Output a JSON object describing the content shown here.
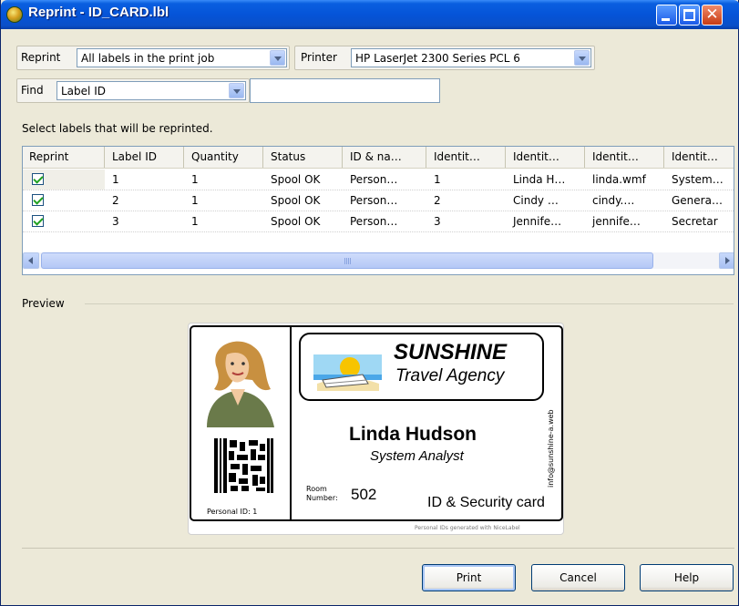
{
  "window": {
    "title": "Reprint - ID_CARD.lbl",
    "close_glyph": "✕"
  },
  "toolbar": {
    "reprint_label": "Reprint",
    "reprint_value": "All labels in the print job",
    "printer_label": "Printer",
    "printer_value": "HP LaserJet 2300 Series PCL 6",
    "find_label": "Find",
    "find_field_value": "Label ID",
    "find_text": ""
  },
  "instruction": "Select labels that will be reprinted.",
  "grid": {
    "columns": [
      "Reprint",
      "Label ID",
      "Quantity",
      "Status",
      "ID & na…",
      "Identit…",
      "Identit…",
      "Identit…",
      "Identit…"
    ],
    "rows": [
      {
        "checked": true,
        "cells": [
          "1",
          "1",
          "Spool OK",
          "Person…",
          "1",
          "Linda H…",
          "linda.wmf",
          "System…"
        ]
      },
      {
        "checked": true,
        "cells": [
          "2",
          "1",
          "Spool OK",
          "Person…",
          "2",
          "Cindy …",
          "cindy.…",
          "Genera…"
        ]
      },
      {
        "checked": true,
        "cells": [
          "3",
          "1",
          "Spool OK",
          "Person…",
          "3",
          "Jennife…",
          "jennife…",
          "Secretar"
        ]
      }
    ]
  },
  "preview": {
    "section_label": "Preview",
    "card": {
      "company": "SUNSHINE",
      "company_sub": "Travel Agency",
      "name": "Linda Hudson",
      "job_title": "System Analyst",
      "room_label": "Room Number:",
      "room_number": "502",
      "card_type": "ID & Security card",
      "personal_id": "Personal ID: 1",
      "website": "info@sunshine-a.web",
      "footer_note": "Personal IDs generated with NiceLabel"
    }
  },
  "buttons": {
    "print": "Print",
    "cancel": "Cancel",
    "help": "Help"
  }
}
